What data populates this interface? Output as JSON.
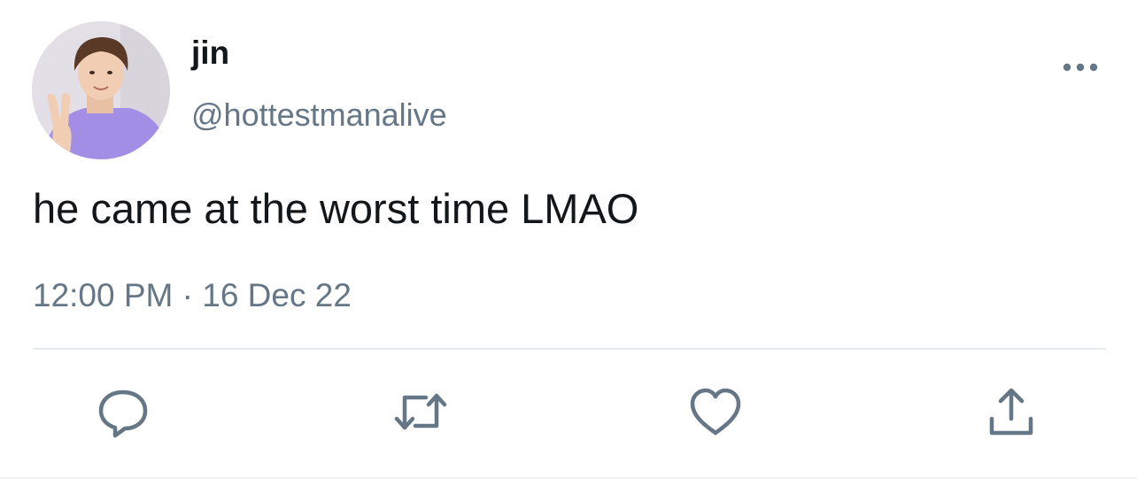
{
  "tweet": {
    "author": {
      "display_name": "jin",
      "handle": "@hottestmanalive",
      "avatar_icon": "profile-photo"
    },
    "text": "he came at the worst time LMAO",
    "timestamp": "12:00 PM · 16 Dec 22",
    "more_icon": "more-horizontal-icon"
  },
  "actions": [
    {
      "name": "reply",
      "icon": "reply-icon"
    },
    {
      "name": "retweet",
      "icon": "retweet-icon"
    },
    {
      "name": "like",
      "icon": "heart-icon"
    },
    {
      "name": "share",
      "icon": "share-icon"
    }
  ],
  "colors": {
    "text_primary": "#14171a",
    "text_secondary": "#657786",
    "icon": "#657786",
    "divider": "#e6ecf0"
  }
}
